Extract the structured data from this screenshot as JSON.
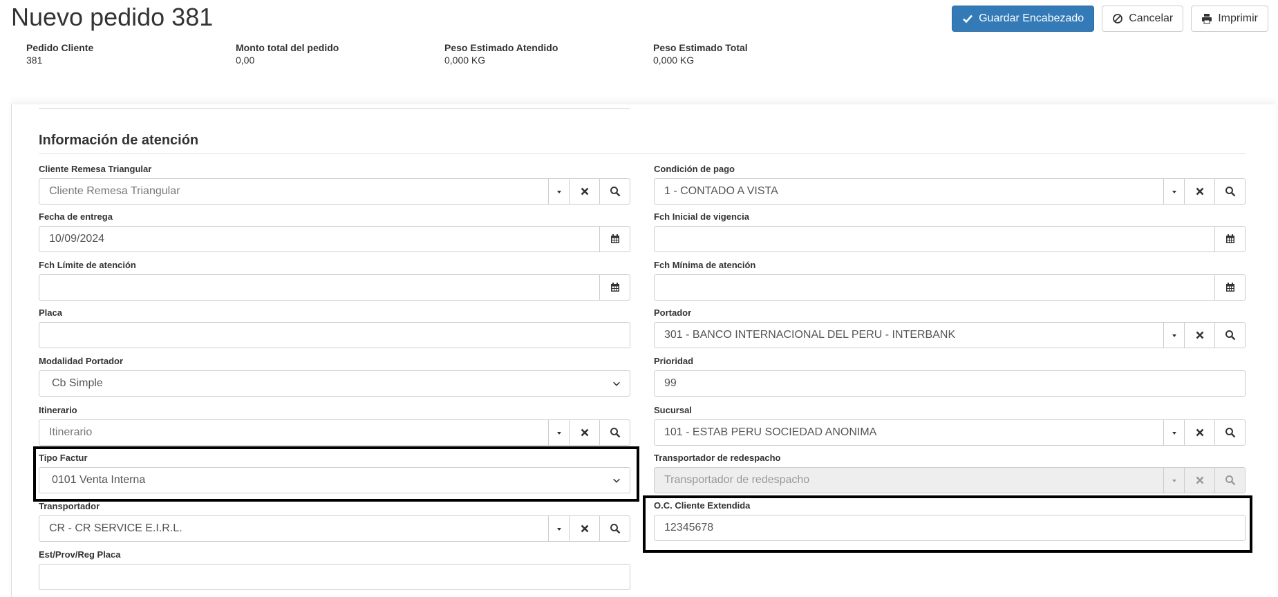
{
  "header": {
    "title": "Nuevo pedido 381",
    "save_label": "Guardar Encabezado",
    "cancel_label": "Cancelar",
    "print_label": "Imprimir"
  },
  "summary": [
    {
      "label": "Pedido Cliente",
      "value": "381"
    },
    {
      "label": "Monto total del pedido",
      "value": "0,00"
    },
    {
      "label": "Peso Estimado Atendido",
      "value": "0,000 KG"
    },
    {
      "label": "Peso Estimado Total",
      "value": "0,000 KG"
    }
  ],
  "section": {
    "title": "Información de atención"
  },
  "fields": {
    "cliente_remesa": {
      "label": "Cliente Remesa Triangular",
      "placeholder": "Cliente Remesa Triangular",
      "value": ""
    },
    "condicion_pago": {
      "label": "Condición de pago",
      "value": "1 - CONTADO A VISTA"
    },
    "fecha_entrega": {
      "label": "Fecha de entrega",
      "value": "10/09/2024"
    },
    "fch_inicial": {
      "label": "Fch Inicial de vigencia",
      "value": ""
    },
    "fch_limite": {
      "label": "Fch Límite de atención",
      "value": ""
    },
    "fch_minima": {
      "label": "Fch Mínima de atención",
      "value": ""
    },
    "placa": {
      "label": "Placa",
      "value": ""
    },
    "portador": {
      "label": "Portador",
      "value": "301 - BANCO INTERNACIONAL DEL PERU - INTERBANK"
    },
    "modalidad_portador": {
      "label": "Modalidad Portador",
      "value": "Cb Simple"
    },
    "prioridad": {
      "label": "Prioridad",
      "value": "99"
    },
    "itinerario": {
      "label": "Itinerario",
      "placeholder": "Itinerario",
      "value": ""
    },
    "sucursal": {
      "label": "Sucursal",
      "value": "101 - ESTAB PERU SOCIEDAD ANONIMA"
    },
    "tipo_factur": {
      "label": "Tipo Factur",
      "value": "0101 Venta Interna"
    },
    "transportador_redespacho": {
      "label": "Transportador de redespacho",
      "placeholder": "Transportador de redespacho",
      "value": ""
    },
    "transportador": {
      "label": "Transportador",
      "value": "CR - CR SERVICE E.I.R.L."
    },
    "oc_cliente_extendida": {
      "label": "O.C. Cliente Extendida",
      "value": "12345678"
    },
    "est_prov_reg_placa": {
      "label": "Est/Prov/Reg Placa",
      "value": ""
    }
  },
  "colors": {
    "primary": "#337ab7",
    "highlight_border": "#000000"
  }
}
